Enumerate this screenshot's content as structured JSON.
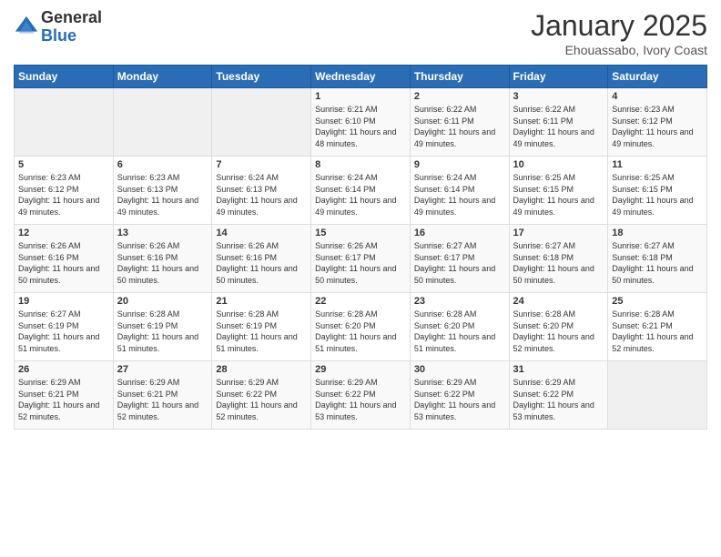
{
  "logo": {
    "general": "General",
    "blue": "Blue"
  },
  "title": "January 2025",
  "subtitle": "Ehouassabo, Ivory Coast",
  "days_of_week": [
    "Sunday",
    "Monday",
    "Tuesday",
    "Wednesday",
    "Thursday",
    "Friday",
    "Saturday"
  ],
  "weeks": [
    [
      {
        "day": "",
        "info": ""
      },
      {
        "day": "",
        "info": ""
      },
      {
        "day": "",
        "info": ""
      },
      {
        "day": "1",
        "info": "Sunrise: 6:21 AM\nSunset: 6:10 PM\nDaylight: 11 hours and 48 minutes."
      },
      {
        "day": "2",
        "info": "Sunrise: 6:22 AM\nSunset: 6:11 PM\nDaylight: 11 hours and 49 minutes."
      },
      {
        "day": "3",
        "info": "Sunrise: 6:22 AM\nSunset: 6:11 PM\nDaylight: 11 hours and 49 minutes."
      },
      {
        "day": "4",
        "info": "Sunrise: 6:23 AM\nSunset: 6:12 PM\nDaylight: 11 hours and 49 minutes."
      }
    ],
    [
      {
        "day": "5",
        "info": "Sunrise: 6:23 AM\nSunset: 6:12 PM\nDaylight: 11 hours and 49 minutes."
      },
      {
        "day": "6",
        "info": "Sunrise: 6:23 AM\nSunset: 6:13 PM\nDaylight: 11 hours and 49 minutes."
      },
      {
        "day": "7",
        "info": "Sunrise: 6:24 AM\nSunset: 6:13 PM\nDaylight: 11 hours and 49 minutes."
      },
      {
        "day": "8",
        "info": "Sunrise: 6:24 AM\nSunset: 6:14 PM\nDaylight: 11 hours and 49 minutes."
      },
      {
        "day": "9",
        "info": "Sunrise: 6:24 AM\nSunset: 6:14 PM\nDaylight: 11 hours and 49 minutes."
      },
      {
        "day": "10",
        "info": "Sunrise: 6:25 AM\nSunset: 6:15 PM\nDaylight: 11 hours and 49 minutes."
      },
      {
        "day": "11",
        "info": "Sunrise: 6:25 AM\nSunset: 6:15 PM\nDaylight: 11 hours and 49 minutes."
      }
    ],
    [
      {
        "day": "12",
        "info": "Sunrise: 6:26 AM\nSunset: 6:16 PM\nDaylight: 11 hours and 50 minutes."
      },
      {
        "day": "13",
        "info": "Sunrise: 6:26 AM\nSunset: 6:16 PM\nDaylight: 11 hours and 50 minutes."
      },
      {
        "day": "14",
        "info": "Sunrise: 6:26 AM\nSunset: 6:16 PM\nDaylight: 11 hours and 50 minutes."
      },
      {
        "day": "15",
        "info": "Sunrise: 6:26 AM\nSunset: 6:17 PM\nDaylight: 11 hours and 50 minutes."
      },
      {
        "day": "16",
        "info": "Sunrise: 6:27 AM\nSunset: 6:17 PM\nDaylight: 11 hours and 50 minutes."
      },
      {
        "day": "17",
        "info": "Sunrise: 6:27 AM\nSunset: 6:18 PM\nDaylight: 11 hours and 50 minutes."
      },
      {
        "day": "18",
        "info": "Sunrise: 6:27 AM\nSunset: 6:18 PM\nDaylight: 11 hours and 50 minutes."
      }
    ],
    [
      {
        "day": "19",
        "info": "Sunrise: 6:27 AM\nSunset: 6:19 PM\nDaylight: 11 hours and 51 minutes."
      },
      {
        "day": "20",
        "info": "Sunrise: 6:28 AM\nSunset: 6:19 PM\nDaylight: 11 hours and 51 minutes."
      },
      {
        "day": "21",
        "info": "Sunrise: 6:28 AM\nSunset: 6:19 PM\nDaylight: 11 hours and 51 minutes."
      },
      {
        "day": "22",
        "info": "Sunrise: 6:28 AM\nSunset: 6:20 PM\nDaylight: 11 hours and 51 minutes."
      },
      {
        "day": "23",
        "info": "Sunrise: 6:28 AM\nSunset: 6:20 PM\nDaylight: 11 hours and 51 minutes."
      },
      {
        "day": "24",
        "info": "Sunrise: 6:28 AM\nSunset: 6:20 PM\nDaylight: 11 hours and 52 minutes."
      },
      {
        "day": "25",
        "info": "Sunrise: 6:28 AM\nSunset: 6:21 PM\nDaylight: 11 hours and 52 minutes."
      }
    ],
    [
      {
        "day": "26",
        "info": "Sunrise: 6:29 AM\nSunset: 6:21 PM\nDaylight: 11 hours and 52 minutes."
      },
      {
        "day": "27",
        "info": "Sunrise: 6:29 AM\nSunset: 6:21 PM\nDaylight: 11 hours and 52 minutes."
      },
      {
        "day": "28",
        "info": "Sunrise: 6:29 AM\nSunset: 6:22 PM\nDaylight: 11 hours and 52 minutes."
      },
      {
        "day": "29",
        "info": "Sunrise: 6:29 AM\nSunset: 6:22 PM\nDaylight: 11 hours and 53 minutes."
      },
      {
        "day": "30",
        "info": "Sunrise: 6:29 AM\nSunset: 6:22 PM\nDaylight: 11 hours and 53 minutes."
      },
      {
        "day": "31",
        "info": "Sunrise: 6:29 AM\nSunset: 6:22 PM\nDaylight: 11 hours and 53 minutes."
      },
      {
        "day": "",
        "info": ""
      }
    ]
  ]
}
